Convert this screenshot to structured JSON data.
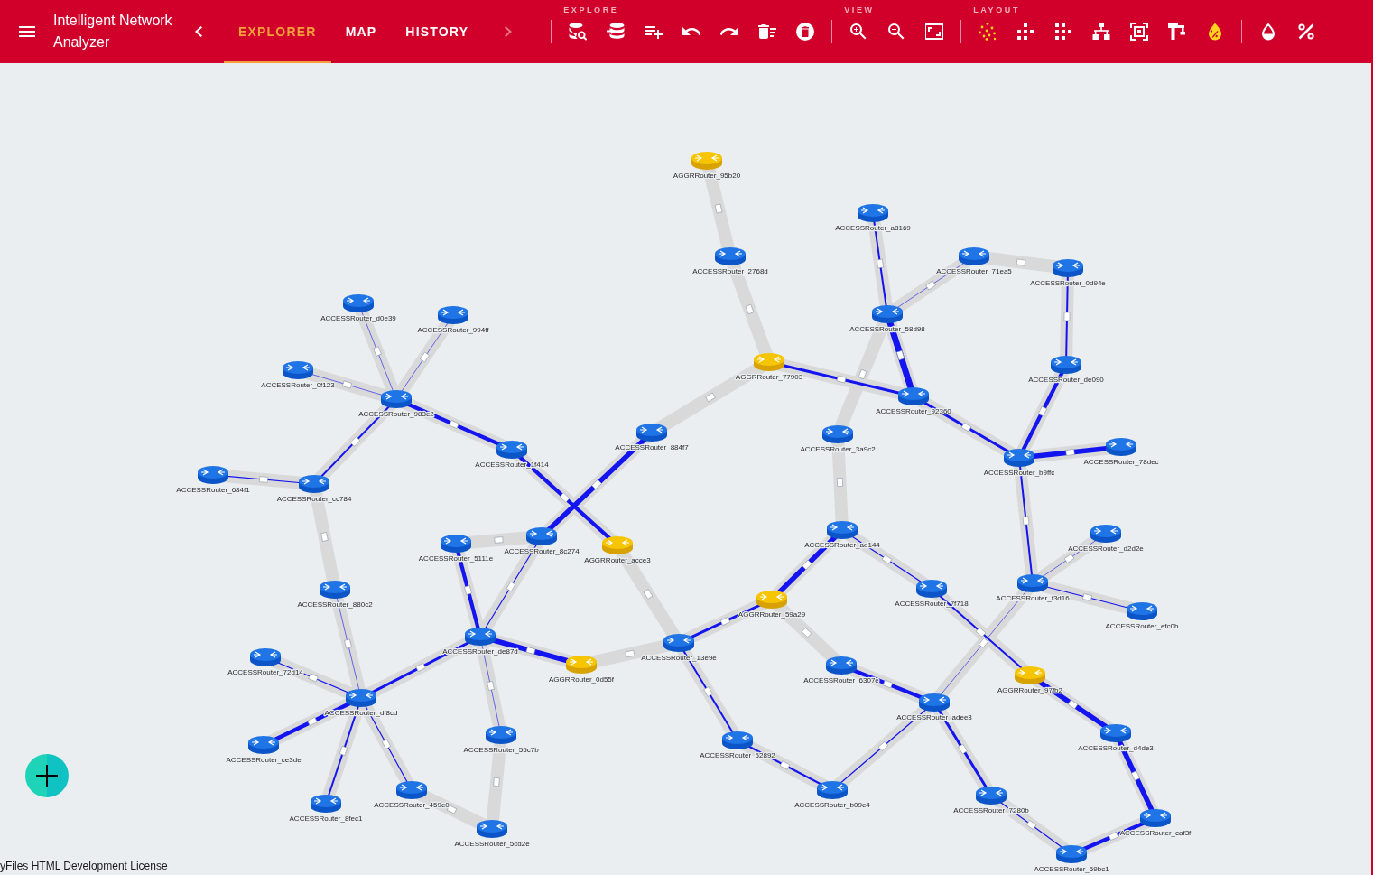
{
  "app_bar": {
    "title": "Intelligent Network Analyzer",
    "scroll_left": {
      "disabled": false
    },
    "scroll_right": {
      "disabled": true
    },
    "tabs": [
      {
        "label": "EXPLORER",
        "selected": true
      },
      {
        "label": "MAP",
        "selected": false
      },
      {
        "label": "HISTORY",
        "selected": false
      }
    ],
    "tool_groups": [
      {
        "label": "EXPLORE"
      },
      {
        "label": "VIEW"
      },
      {
        "label": "LAYOUT",
        "buttons": [
          {
            "active": true
          },
          {
            "active": false
          },
          {
            "active": false
          },
          {
            "active": false
          },
          {
            "active": false
          },
          {
            "active": false
          },
          {
            "active": true
          }
        ]
      }
    ]
  },
  "network": {
    "nodes": [
      {
        "label": "AGGRRouter_95b20",
        "kind": "aggregation"
      },
      {
        "label": "ACCESSRouter_2768d",
        "kind": "access"
      },
      {
        "label": "AGGRRouter_77903",
        "kind": "aggregation"
      },
      {
        "label": "ACCESSRouter_a8169",
        "kind": "access"
      },
      {
        "label": "ACCESSRouter_71ea5",
        "kind": "access"
      },
      {
        "label": "ACCESSRouter_0d94e",
        "kind": "access"
      },
      {
        "label": "ACCESSRouter_58d98",
        "kind": "access"
      },
      {
        "label": "ACCESSRouter_de090",
        "kind": "access"
      },
      {
        "label": "ACCESSRouter_92360",
        "kind": "access"
      },
      {
        "label": "ACCESSRouter_3a9c2",
        "kind": "access"
      },
      {
        "label": "ACCESSRouter_b9ffc",
        "kind": "access"
      },
      {
        "label": "ACCESSRouter_78dec",
        "kind": "access"
      },
      {
        "label": "ACCESSRouter_884f7",
        "kind": "access"
      },
      {
        "label": "ACCESSRouter_d0e39",
        "kind": "access"
      },
      {
        "label": "ACCESSRouter_994ff",
        "kind": "access"
      },
      {
        "label": "ACCESSRouter_0f123",
        "kind": "access"
      },
      {
        "label": "ACCESSRouter_983e2",
        "kind": "access"
      },
      {
        "label": "ACCESSRouter_1f414",
        "kind": "access"
      },
      {
        "label": "ACCESSRouter_684f1",
        "kind": "access"
      },
      {
        "label": "ACCESSRouter_cc784",
        "kind": "access"
      },
      {
        "label": "ACCESSRouter_880c2",
        "kind": "access"
      },
      {
        "label": "ACCESSRouter_5111e",
        "kind": "access"
      },
      {
        "label": "ACCESSRouter_8c274",
        "kind": "access"
      },
      {
        "label": "AGGRRouter_acce3",
        "kind": "aggregation"
      },
      {
        "label": "ACCESSRouter_de87d",
        "kind": "access"
      },
      {
        "label": "AGGRRouter_0d55f",
        "kind": "aggregation"
      },
      {
        "label": "ACCESSRouter_72d14",
        "kind": "access"
      },
      {
        "label": "ACCESSRouter_df8cd",
        "kind": "access"
      },
      {
        "label": "ACCESSRouter_ce3de",
        "kind": "access"
      },
      {
        "label": "ACCESSRouter_8fec1",
        "kind": "access"
      },
      {
        "label": "ACCESSRouter_459e0",
        "kind": "access"
      },
      {
        "label": "ACCESSRouter_55c7b",
        "kind": "access"
      },
      {
        "label": "ACCESSRouter_5cd2e",
        "kind": "access"
      },
      {
        "label": "ACCESSRouter_ad144",
        "kind": "access"
      },
      {
        "label": "AGGRRouter_59a29",
        "kind": "aggregation"
      },
      {
        "label": "ACCESSRouter_13e9e",
        "kind": "access"
      },
      {
        "label": "ACCESSRouter_7f718",
        "kind": "access"
      },
      {
        "label": "ACCESSRouter_f3d16",
        "kind": "access"
      },
      {
        "label": "ACCESSRouter_d2d2e",
        "kind": "access"
      },
      {
        "label": "ACCESSRouter_efc0b",
        "kind": "access"
      },
      {
        "label": "ACCESSRouter_6307e",
        "kind": "access"
      },
      {
        "label": "AGGRRouter_97fb2",
        "kind": "aggregation"
      },
      {
        "label": "ACCESSRouter_adee3",
        "kind": "access"
      },
      {
        "label": "ACCESSRouter_52892",
        "kind": "access"
      },
      {
        "label": "ACCESSRouter_b09e4",
        "kind": "access"
      },
      {
        "label": "ACCESSRouter_d4de3",
        "kind": "access"
      },
      {
        "label": "ACCESSRouter_7280b",
        "kind": "access"
      },
      {
        "label": "ACCESSRouter_caf3f",
        "kind": "access"
      },
      {
        "label": "ACCESSRouter_59bc1",
        "kind": "access"
      }
    ],
    "links": [
      {
        "kind": "idle"
      },
      {
        "kind": "idle"
      },
      {
        "kind": "idle"
      },
      {
        "kind": "medium"
      },
      {
        "kind": "low"
      },
      {
        "kind": "trace"
      },
      {
        "kind": "idle"
      },
      {
        "kind": "low"
      },
      {
        "kind": "peak"
      },
      {
        "kind": "idle"
      },
      {
        "kind": "medium"
      },
      {
        "kind": "high"
      },
      {
        "kind": "heavy"
      },
      {
        "kind": "low"
      },
      {
        "kind": "idle"
      },
      {
        "kind": "heavy"
      },
      {
        "kind": "high"
      },
      {
        "kind": "high"
      },
      {
        "kind": "trace"
      },
      {
        "kind": "trace"
      },
      {
        "kind": "trace"
      },
      {
        "kind": "low"
      },
      {
        "kind": "thin"
      },
      {
        "kind": "idle"
      },
      {
        "kind": "trace"
      },
      {
        "kind": "idle"
      },
      {
        "kind": "high"
      },
      {
        "kind": "thin"
      },
      {
        "kind": "idle"
      },
      {
        "kind": "heavy"
      },
      {
        "kind": "idle"
      },
      {
        "kind": "medium"
      },
      {
        "kind": "trace"
      },
      {
        "kind": "idle"
      },
      {
        "kind": "idle"
      },
      {
        "kind": "thin"
      },
      {
        "kind": "high"
      },
      {
        "kind": "low"
      },
      {
        "kind": "thin"
      },
      {
        "kind": "medium"
      },
      {
        "kind": "heavy"
      },
      {
        "kind": "idle"
      },
      {
        "kind": "thin"
      },
      {
        "kind": "low"
      },
      {
        "kind": "trace"
      },
      {
        "kind": "thin"
      },
      {
        "kind": "trace"
      },
      {
        "kind": "high"
      },
      {
        "kind": "low"
      },
      {
        "kind": "low"
      },
      {
        "kind": "thin"
      },
      {
        "kind": "medium"
      },
      {
        "kind": "heavy"
      },
      {
        "kind": "heavy"
      },
      {
        "kind": "high"
      },
      {
        "kind": "thin"
      }
    ]
  },
  "license": "yFiles HTML Development License"
}
